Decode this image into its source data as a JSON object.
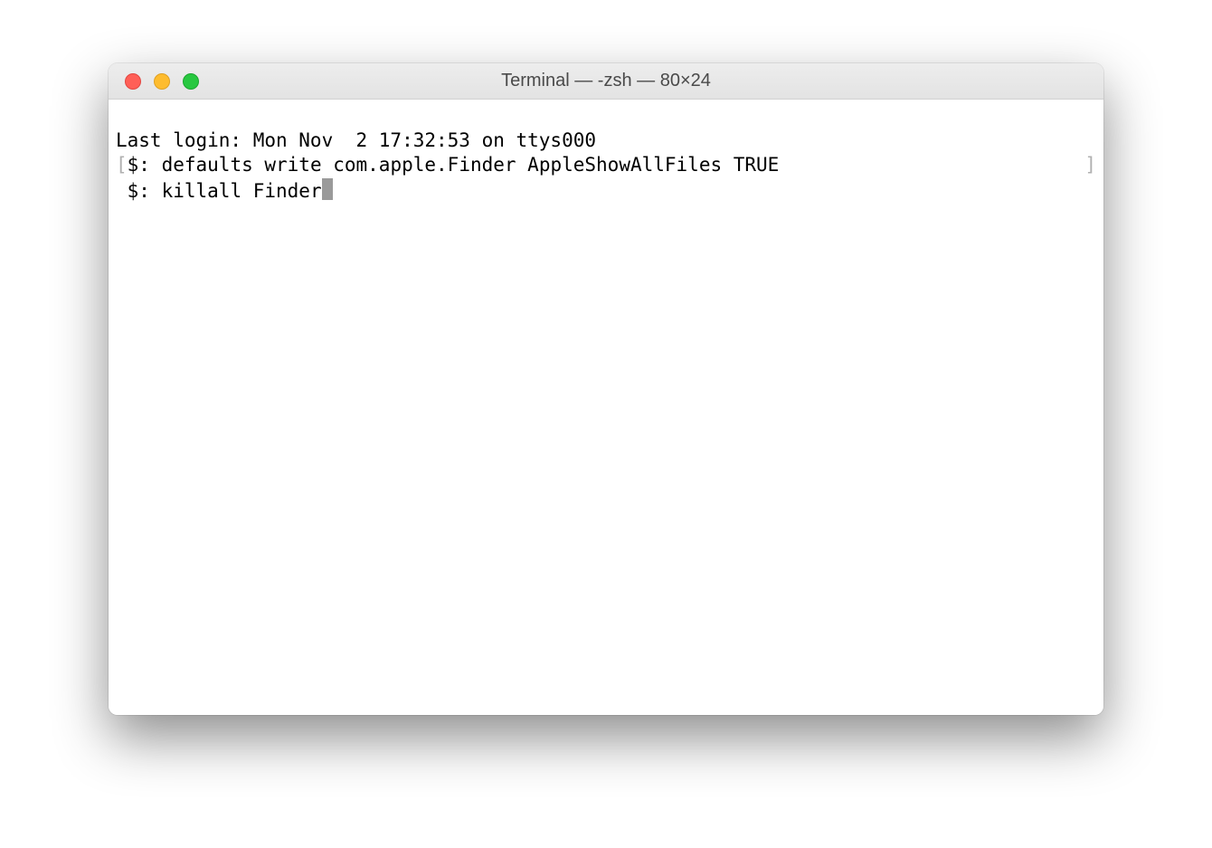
{
  "window": {
    "title": "Terminal — -zsh — 80×24"
  },
  "terminal": {
    "lines": [
      {
        "type": "plain",
        "text": "Last login: Mon Nov  2 17:32:53 on ttys000"
      },
      {
        "type": "bracketed",
        "left_bracket": "[",
        "prompt": "$: ",
        "command": "defaults write com.apple.Finder AppleShowAllFiles TRUE",
        "right_bracket": "]"
      },
      {
        "type": "prompt-cursor",
        "prompt": "$: ",
        "command": "killall Finder"
      }
    ]
  },
  "colors": {
    "close": "#ff5f57",
    "minimize": "#febc2e",
    "maximize": "#28c840",
    "titlebar_text": "#4a4a4a",
    "bracket": "#b0b0b0",
    "cursor": "#9a9a9a"
  }
}
